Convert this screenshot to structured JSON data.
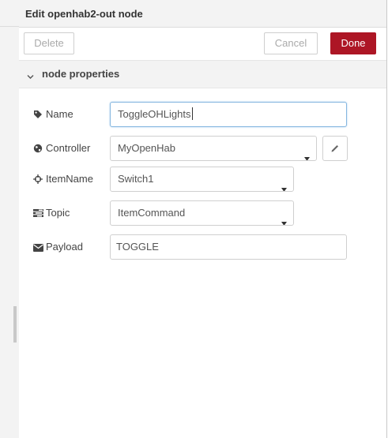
{
  "tray": {
    "title": "Edit openhab2-out node",
    "buttons": {
      "delete_label": "Delete",
      "cancel_label": "Cancel",
      "done_label": "Done"
    },
    "section": {
      "title": "node properties",
      "icon": "chevron-down-icon"
    }
  },
  "form": {
    "name": {
      "label": "Name",
      "icon": "tag-icon",
      "value": "ToggleOHLights"
    },
    "controller": {
      "label": "Controller",
      "icon": "globe-icon",
      "selected": "MyOpenHab",
      "edit_icon": "pencil-icon"
    },
    "itemname": {
      "label": "ItemName",
      "icon": "crosshairs-icon",
      "selected": "Switch1"
    },
    "topic": {
      "label": "Topic",
      "icon": "tasks-icon",
      "selected": "ItemCommand"
    },
    "payload": {
      "label": "Payload",
      "icon": "envelope-icon",
      "value": "TOGGLE"
    }
  },
  "colors": {
    "done_button": "#ad1625",
    "header_bg": "#f3f3f3",
    "focus_border": "#85b7e0"
  }
}
